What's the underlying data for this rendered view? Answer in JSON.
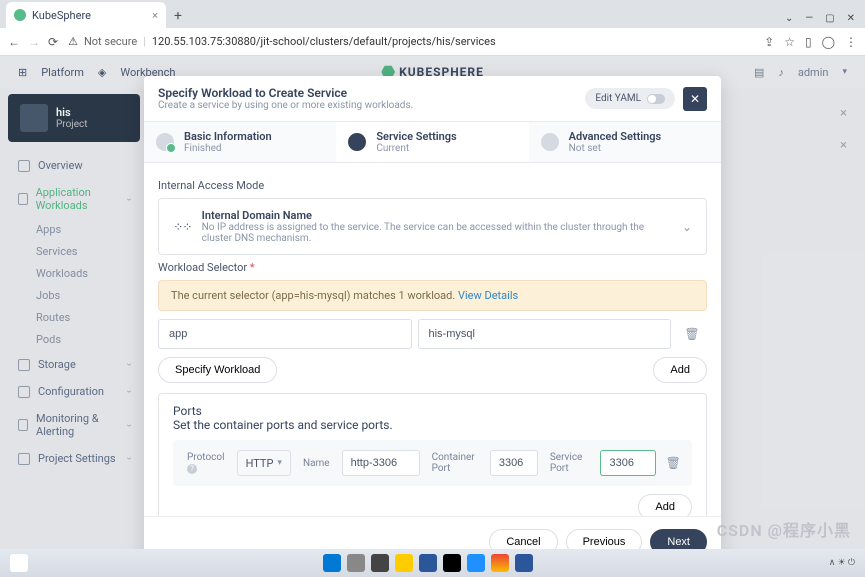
{
  "browser": {
    "tab_title": "KubeSphere",
    "url": "120.55.103.75:30880/jit-school/clusters/default/projects/his/services",
    "not_secure": "Not secure"
  },
  "header": {
    "platform": "Platform",
    "workbench": "Workbench",
    "brand": "KUBESPHERE",
    "user": "admin"
  },
  "project": {
    "name": "his",
    "sub": "Project"
  },
  "sidebar": {
    "overview": "Overview",
    "app_workloads": "Application Workloads",
    "subs": [
      "Apps",
      "Services",
      "Workloads",
      "Jobs",
      "Routes",
      "Pods"
    ],
    "storage": "Storage",
    "configuration": "Configuration",
    "monitoring": "Monitoring & Alerting",
    "project_settings": "Project Settings"
  },
  "modal": {
    "title": "Specify Workload to Create Service",
    "subtitle": "Create a service by using one or more existing workloads.",
    "edit_yaml": "Edit YAML",
    "steps": [
      {
        "title": "Basic Information",
        "sub": "Finished"
      },
      {
        "title": "Service Settings",
        "sub": "Current"
      },
      {
        "title": "Advanced Settings",
        "sub": "Not set"
      }
    ],
    "access_mode_label": "Internal Access Mode",
    "access_mode": {
      "title": "Internal Domain Name",
      "desc": "No IP address is assigned to the service. The service can be accessed within the cluster through the cluster DNS mechanism."
    },
    "workload_selector_label": "Workload Selector",
    "selector_notice": "The current selector (app=his-mysql) matches 1 workload.",
    "view_details": "View Details",
    "kv": {
      "key": "app",
      "val": "his-mysql"
    },
    "specify_workload": "Specify Workload",
    "add": "Add",
    "ports": {
      "title": "Ports",
      "desc": "Set the container ports and service ports.",
      "protocol_label": "Protocol",
      "protocol_value": "HTTP",
      "name_label": "Name",
      "name_value": "http-3306",
      "container_port_label": "Container Port",
      "container_port_value": "3306",
      "service_port_label": "Service Port",
      "service_port_value": "3306"
    },
    "cancel": "Cancel",
    "previous": "Previous",
    "next": "Next"
  },
  "watermark": "CSDN @程序小黑"
}
